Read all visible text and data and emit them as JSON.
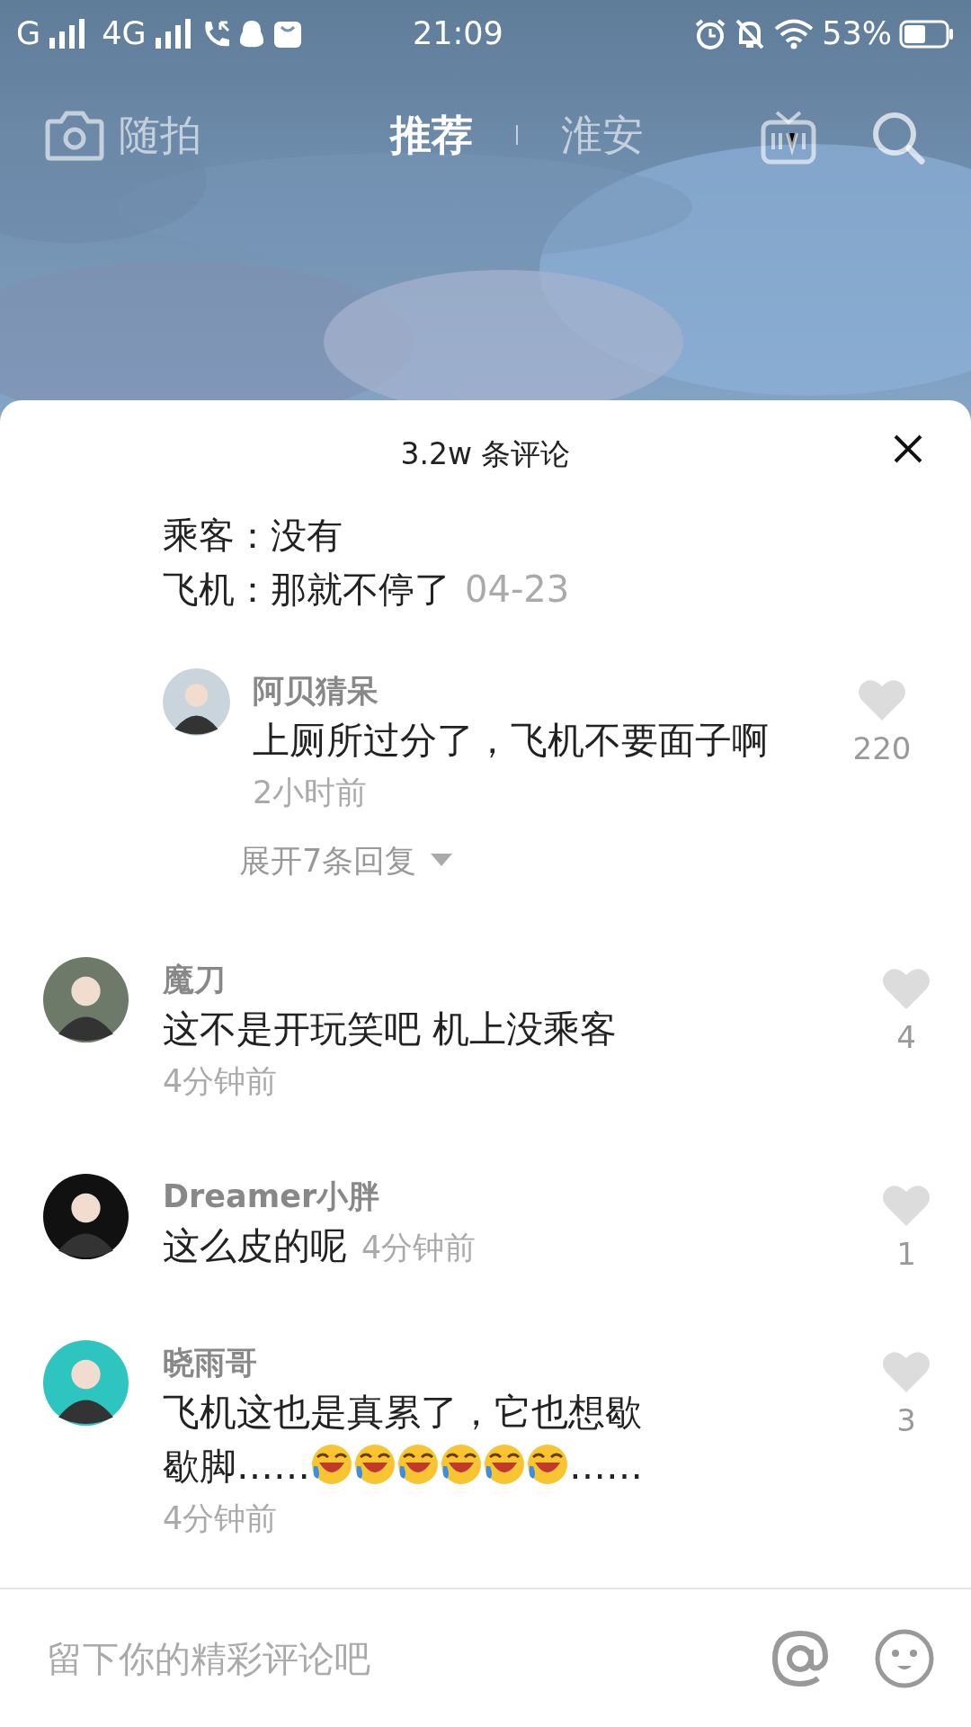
{
  "status_bar": {
    "network_1": "G",
    "network_2": "4G",
    "time": "21:09",
    "battery": "53%"
  },
  "top_nav": {
    "camera_label": "随拍",
    "tabs": [
      {
        "label": "推荐",
        "selected": true
      },
      {
        "label": "淮安",
        "selected": false
      }
    ]
  },
  "comments_sheet": {
    "title": "3.2w 条评论",
    "partial_comment": {
      "lines": [
        "乘客：没有",
        "飞机：那就不停了"
      ],
      "time": "04-23"
    },
    "reply": {
      "user": "阿贝猜呆",
      "text": "上厕所过分了，飞机不要面子啊",
      "time": "2小时前",
      "likes": "220",
      "liked": false
    },
    "expand_replies": "展开7条回复",
    "comments": [
      {
        "kind": "time_below",
        "user": "魔刀",
        "lines": [
          [
            {
              "kind": "text",
              "text": "这不是开玩笑吧 机上没乘客"
            }
          ]
        ],
        "time": "4分钟前",
        "likes": "4",
        "liked": false
      },
      {
        "kind": "time_inline",
        "user": "Dreamer小胖",
        "lines": [
          [
            {
              "kind": "text",
              "text": "这么皮的呢"
            }
          ]
        ],
        "time": "4分钟前",
        "likes": "1",
        "liked": false
      },
      {
        "kind": "time_below",
        "user": "晓雨哥",
        "lines": [
          [
            {
              "kind": "text",
              "text": "飞机这也是真累了，它也想歇"
            }
          ],
          [
            {
              "kind": "text",
              "text": "歇脚……"
            },
            {
              "kind": "emoji"
            },
            {
              "kind": "emoji"
            },
            {
              "kind": "emoji"
            },
            {
              "kind": "emoji"
            },
            {
              "kind": "emoji"
            },
            {
              "kind": "emoji"
            },
            {
              "kind": "text",
              "text": "……"
            }
          ]
        ],
        "time": "4分钟前",
        "likes": "3",
        "liked": false
      }
    ],
    "input": {
      "placeholder": "留下你的精彩评论吧"
    }
  }
}
